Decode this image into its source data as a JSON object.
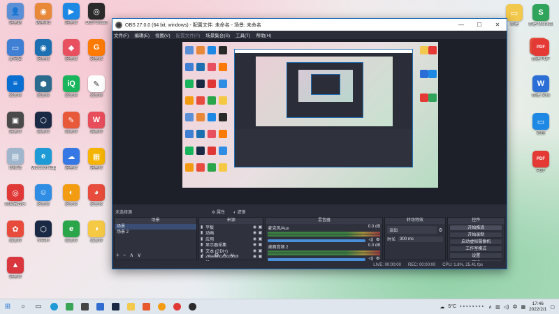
{
  "desktop_left": [
    {
      "label": "这里是",
      "color": "#5b8fd6",
      "glyph": "👤"
    },
    {
      "label": "这里用2",
      "color": "#e8893a",
      "glyph": "◉"
    },
    {
      "label": "这里修",
      "color": "#1e88e5",
      "glyph": "▶"
    },
    {
      "label": "OBS Studio",
      "color": "#2a2a2a",
      "glyph": "◎"
    },
    {
      "label": "此电脑",
      "color": "#3f7fd4",
      "glyph": "▭"
    },
    {
      "label": "这里修",
      "color": "#1c6fb0",
      "glyph": "◉"
    },
    {
      "label": "这里修",
      "color": "#e84f5f",
      "glyph": "◆"
    },
    {
      "label": "这里修",
      "color": "#ff7a00",
      "glyph": "G"
    },
    {
      "label": "这里修",
      "color": "#0a6fd1",
      "glyph": "≡"
    },
    {
      "label": "这里修",
      "color": "#2a6b8e",
      "glyph": "⬢"
    },
    {
      "label": "这里修",
      "color": "#19b55c",
      "glyph": "iQ"
    },
    {
      "label": "这里修",
      "color": "#ffffff",
      "glyph": "✎"
    },
    {
      "label": "这里修",
      "color": "#4a4a4a",
      "glyph": "▣"
    },
    {
      "label": "这里修",
      "color": "#1b2a44",
      "glyph": "⬡"
    },
    {
      "label": "这里修",
      "color": "#e8593a",
      "glyph": "✎"
    },
    {
      "label": "这里修",
      "color": "#e84d5b",
      "glyph": "W"
    },
    {
      "label": "回收站",
      "color": "#9fb6cc",
      "glyph": "▤"
    },
    {
      "label": "Microsoft Edge",
      "color": "#1e9ad6",
      "glyph": "e"
    },
    {
      "label": "这里修",
      "color": "#3578e5",
      "glyph": "☁"
    },
    {
      "label": "这里修",
      "color": "#f5b400",
      "glyph": "▦"
    },
    {
      "label": "网易云音乐",
      "color": "#e03737",
      "glyph": "◎"
    },
    {
      "label": "这里修",
      "color": "#2f8de4",
      "glyph": "☺"
    },
    {
      "label": "这里修",
      "color": "#f39c12",
      "glyph": "◐"
    },
    {
      "label": "这里修",
      "color": "#e74c3c",
      "glyph": "◕"
    },
    {
      "label": "这里修",
      "color": "#e84b3c",
      "glyph": "✿"
    },
    {
      "label": "Steam",
      "color": "#1b2a44",
      "glyph": "⬡"
    },
    {
      "label": "这里修",
      "color": "#2aa54a",
      "glyph": "e"
    },
    {
      "label": "这里修",
      "color": "#f6c945",
      "glyph": "◑"
    },
    {
      "label": "这里修",
      "color": "#d9363e",
      "glyph": "▲"
    }
  ],
  "desktop_right": [
    {
      "label": "新建",
      "color": "#f2c94c",
      "glyph": "▭"
    },
    {
      "label": "新建 Microsoft...",
      "color": "#2fa45a",
      "glyph": "S"
    },
    {
      "label": "",
      "color": "#e74c3c",
      "glyph": "▤"
    },
    {
      "label": "新建 PDF",
      "color": "#e53935",
      "glyph": "PDF"
    },
    {
      "label": "新建 文档",
      "color": "#2b6fd6",
      "glyph": "W"
    },
    {
      "label": "远程",
      "color": "#1e88e5",
      "glyph": "▭"
    },
    {
      "label": "PDF",
      "color": "#e53935",
      "glyph": "PDF"
    }
  ],
  "obs": {
    "title": "OBS 27.0.0 (64 bit, windows) - 配置文件: 未命名 - 场景: 未命名",
    "menu": [
      "文件(F)",
      "编辑(E)",
      "视图(V)",
      "配置文件(P)",
      "场景集合(S)",
      "工具(T)",
      "帮助(H)"
    ],
    "menu_dim": [
      false,
      false,
      false,
      true,
      false,
      false,
      false
    ],
    "scene_bar": {
      "label": "未选择源",
      "prop": "属性",
      "filter": "滤镜"
    },
    "scenes": {
      "header": "场景",
      "items": [
        "场景",
        "场景 2"
      ]
    },
    "sources": {
      "header": "来源",
      "items": [
        "平板",
        "动画",
        "应用",
        "显示器采集",
        "文本 (GDI+)",
        "2eaafdic25cd56dl",
        "11"
      ]
    },
    "mixer": {
      "header": "混音器",
      "channels": [
        {
          "name": "麦克风/Aux",
          "db": "0.0 dB"
        },
        {
          "name": "桌面音频 2",
          "db": "0.0 dB"
        }
      ]
    },
    "transitions": {
      "header": "转场特效",
      "type": "淡出",
      "duration_label": "时长",
      "duration": "300 ms"
    },
    "controls": {
      "header": "控件",
      "buttons": [
        "开始推流",
        "开始录制",
        "启动虚拟摄像机",
        "工作室模式",
        "设置",
        "退出"
      ]
    },
    "status": {
      "live": "LIVE: 00:00:00",
      "rec": "REC: 00:00:00",
      "cpu": "CPU: 1.8%, 25.41 fps"
    }
  },
  "taskbar": {
    "weather": "5°C",
    "time": "17:46",
    "date": "2022/2/1",
    "ime": "中"
  }
}
